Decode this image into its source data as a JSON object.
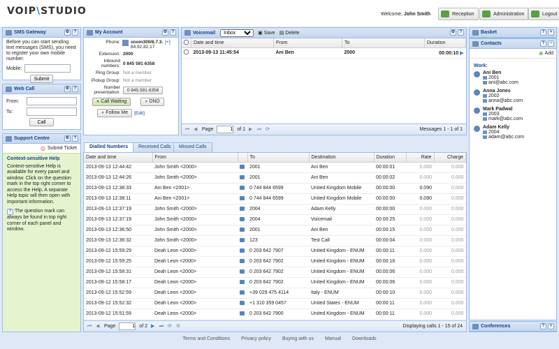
{
  "brand": {
    "logo_left": "VOIP",
    "logo_sep": "\\",
    "logo_right": "STUDIO"
  },
  "header": {
    "welcome": "Welcome,",
    "user": "John Smith",
    "buttons": [
      "Reception",
      "Administration",
      "Logout"
    ]
  },
  "sms": {
    "title": "SMS Gateway",
    "text": "Before you can start sending text messages (SMS), you need to register your own mobile number.",
    "mobile_label": "Mobile:",
    "submit": "Submit"
  },
  "webcall": {
    "title": "Web Call",
    "from_label": "From:",
    "to_label": "To:",
    "call": "Call"
  },
  "support": {
    "title": "Support Centre",
    "submit_ticket": "Submit Ticket",
    "heading": "Context-sensitive Help",
    "body": "Context-sensitive Help is available for every panel and window. Click on the question mark in the top right corner to access the Help. A separate Help topic will then open with important information.",
    "body2": "The question mark can always be found in top right corner of each panel and window."
  },
  "account": {
    "title": "My Account",
    "phone_label": "Phone:",
    "phone": "snom300/8.7.3.",
    "phone_ip": "84.92.82.17",
    "phone_more": "[+]",
    "ext_label": "Extension:",
    "ext": "2000",
    "inbound_label": "Inbound numbers:",
    "inbound": "0 845 591 6358",
    "ring_label": "Ring Group:",
    "ring": "Not a member",
    "pickup_label": "Pickup Group:",
    "pickup": "Not a member",
    "pres_label": "Number presentation:",
    "pres": "0 845.591.6358",
    "call_waiting": "Call Waiting",
    "dnd": "DND",
    "follow_me": "Follow Me",
    "edit": "[Edit]"
  },
  "voicemail": {
    "title": "Voicemail",
    "folder": "Inbox",
    "save": "Save",
    "delete": "Delete",
    "columns": [
      "Date and time",
      "From",
      "To",
      "Duration"
    ],
    "rows": [
      {
        "date": "2013-09-13 11:45:54",
        "from": "Ani Ben",
        "to": "2000",
        "duration": "00:00:10"
      }
    ],
    "page_label": "Page",
    "page": "1",
    "of": "of 1",
    "status": "Messages 1 - 1 of 1"
  },
  "calls": {
    "tabs": [
      "Dialled Numbers",
      "Received Calls",
      "Missed Calls"
    ],
    "columns": [
      "Date and time",
      "From",
      "To",
      "Destination",
      "Duration",
      "Rate",
      "Charge"
    ],
    "rows": [
      {
        "date": "2013-09-13 12:44:42",
        "from": "John Smith <2000>",
        "to": "2001",
        "dest": "Ani Ben",
        "dur": "00:00:01",
        "rate": "0.000",
        "charge": "0.000"
      },
      {
        "date": "2013-09-13 12:44:26",
        "from": "John Smith <2000>",
        "to": "2001",
        "dest": "Ani Ben",
        "dur": "00:00:02",
        "rate": "0.000",
        "charge": "0.000"
      },
      {
        "date": "2013-09-13 12:38:33",
        "from": "Ani Ben <2001>",
        "to": "0 744 844 6599",
        "dest": "United Kingdom Mobile",
        "dur": "00:00:00",
        "rate": "0.090",
        "charge": "0.000"
      },
      {
        "date": "2013-09-13 12:38:11",
        "from": "Ani Ben <2001>",
        "to": "0 744 844 6599",
        "dest": "United Kingdom Mobile",
        "dur": "00:00:00",
        "rate": "0.090",
        "charge": "0.000"
      },
      {
        "date": "2013-09-13 12:37:19",
        "from": "John Smith <2000>",
        "to": "2004",
        "dest": "Adam Kelly",
        "dur": "00:00:00",
        "rate": "0.000",
        "charge": "0.000"
      },
      {
        "date": "2013-09-13 12:37:19",
        "from": "John Smith <2000>",
        "to": "2004",
        "dest": "Voicemail",
        "dur": "00:00:25",
        "rate": "0.000",
        "charge": "0.000"
      },
      {
        "date": "2013-09-13 12:36:50",
        "from": "John Smith <2000>",
        "to": "2001",
        "dest": "Ani Ben",
        "dur": "00:00:15",
        "rate": "0.000",
        "charge": "0.000"
      },
      {
        "date": "2013-09-13 12:36:32",
        "from": "John Smith <2000>",
        "to": "123",
        "dest": "Test Call",
        "dur": "00:00:04",
        "rate": "0.000",
        "charge": "0.000"
      },
      {
        "date": "2013-09-12 15:59:29",
        "from": "Deah Leon <2000>",
        "to": "0 203 642 7907",
        "dest": "United Kingdom - ENUM",
        "dur": "00:00:11",
        "rate": "0.000",
        "charge": "0.000"
      },
      {
        "date": "2013-09-12 15:59:25",
        "from": "Deah Leon <2000>",
        "to": "0 203 642 7902",
        "dest": "United Kingdom - ENUM",
        "dur": "00:00:16",
        "rate": "0.000",
        "charge": "0.000"
      },
      {
        "date": "2013-09-12 15:58:31",
        "from": "Deah Leon <2000>",
        "to": "0 203 642 7902",
        "dest": "United Kingdom - ENUM",
        "dur": "00:00:06",
        "rate": "0.000",
        "charge": "0.000"
      },
      {
        "date": "2013-09-12 15:58:17",
        "from": "Deah Leon <2000>",
        "to": "0 203 642 7902",
        "dest": "United Kingdom - ENUM",
        "dur": "00:00:06",
        "rate": "0.000",
        "charge": "0.000"
      },
      {
        "date": "2013-09-12 15:52:59",
        "from": "Deah Leon <2000>",
        "to": "+39 029 475 4114",
        "dest": "Italy - ENUM",
        "dur": "00:00:10",
        "rate": "0.000",
        "charge": "0.000"
      },
      {
        "date": "2013-09-12 15:52:32",
        "from": "Deah Leon <2000>",
        "to": "+1 310 359 0457",
        "dest": "United States - ENUM",
        "dur": "00:00:11",
        "rate": "0.000",
        "charge": "0.000"
      },
      {
        "date": "2013-09-12 15:51:59",
        "from": "Deah Leon <2000>",
        "to": "0 203 642 7900",
        "dest": "United Kingdom - ENUM",
        "dur": "00:00:11",
        "rate": "0.000",
        "charge": "0.000"
      }
    ],
    "page_label": "Page",
    "page": "1",
    "of": "of 2",
    "status": "Displaying calls 1 - 15 of 24"
  },
  "basket": {
    "title": "Basket"
  },
  "contacts": {
    "title": "Contacts",
    "add": "Add",
    "group": "Work:",
    "items": [
      {
        "name": "Ani Ben",
        "ext": "2001",
        "email": "ani@abc.com"
      },
      {
        "name": "Anna Jones",
        "ext": "2002",
        "email": "anna@abc.com"
      },
      {
        "name": "Mark Padwal",
        "ext": "2003",
        "email": "mark@abc.com"
      },
      {
        "name": "Adam Kelly",
        "ext": "2004",
        "email": "adam@abc.com"
      }
    ]
  },
  "conferences": {
    "title": "Conferences"
  },
  "footer": [
    "Terms and Conditions",
    "Privacy policy",
    "Buying with us",
    "Manual",
    "Downloads"
  ]
}
